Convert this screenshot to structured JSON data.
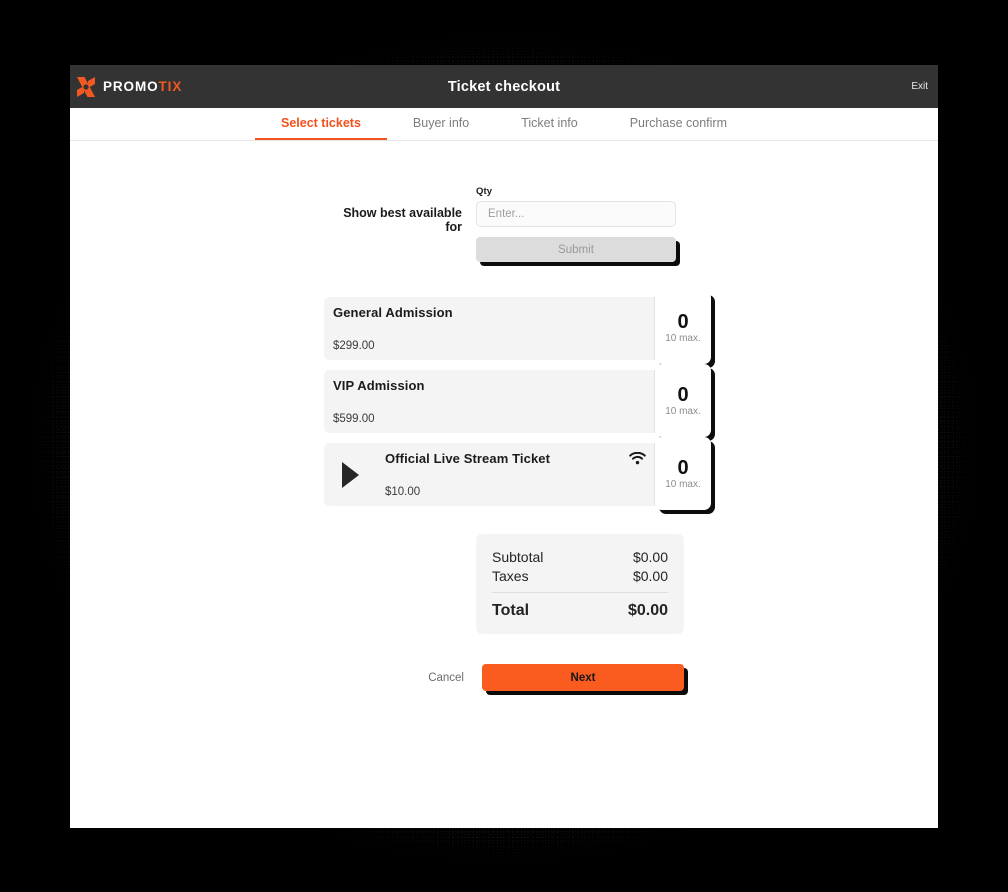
{
  "appbar": {
    "brand_primary": "PROMO",
    "brand_accent": "TIX",
    "title": "Ticket checkout",
    "exit_label": "Exit",
    "bar_color": "#333333",
    "accent_color": "#f05a22"
  },
  "tabs": [
    {
      "label": "Select tickets",
      "active": true
    },
    {
      "label": "Buyer info",
      "active": false
    },
    {
      "label": "Ticket info",
      "active": false
    },
    {
      "label": "Purchase confirm",
      "active": false
    }
  ],
  "best_available": {
    "label": "Show best available for",
    "qty_label": "Qty",
    "qty_value": "",
    "qty_placeholder": "Enter...",
    "submit_label": "Submit"
  },
  "tickets": [
    {
      "name": "General Admission",
      "price": "$299.00",
      "count": "0",
      "max_label": "10 max.",
      "plus_label": "+",
      "minus_label": "–",
      "has_play_icon": false,
      "has_stream_icon": false
    },
    {
      "name": "VIP Admission",
      "price": "$599.00",
      "count": "0",
      "max_label": "10 max.",
      "plus_label": "+",
      "minus_label": "–",
      "has_play_icon": false,
      "has_stream_icon": false
    },
    {
      "name": "Official Live Stream Ticket",
      "price": "$10.00",
      "count": "0",
      "max_label": "10 max.",
      "plus_label": "+",
      "minus_label": "–",
      "has_play_icon": true,
      "has_stream_icon": true
    }
  ],
  "totals": {
    "subtotal_label": "Subtotal",
    "subtotal_value": "$0.00",
    "taxes_label": "Taxes",
    "taxes_value": "$0.00",
    "total_label": "Total",
    "total_value": "$0.00"
  },
  "actions": {
    "cancel_label": "Cancel",
    "next_label": "Next",
    "next_color": "#fa5b1e"
  }
}
